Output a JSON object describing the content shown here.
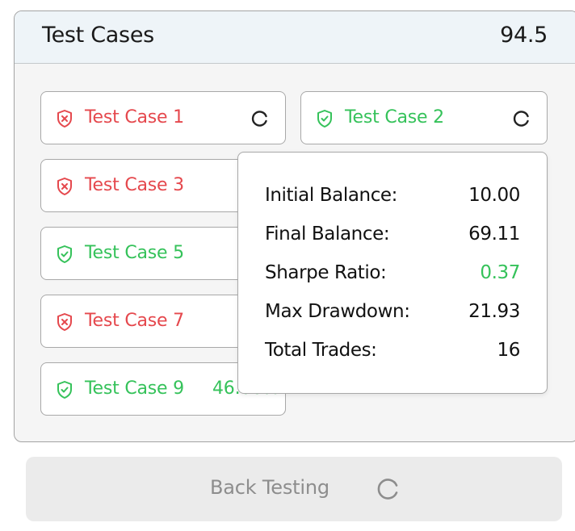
{
  "panel": {
    "title": "Test Cases",
    "score": "94.5"
  },
  "colors": {
    "fail": "#e5484d",
    "pass": "#35c25a",
    "header_bg": "#eef4f8",
    "panel_bg": "#f5f5f5",
    "button_bg": "#ebebeb"
  },
  "test_cases": [
    {
      "label": "Test Case 1",
      "status": "fail",
      "icon": "shield-x-icon",
      "loading": true
    },
    {
      "label": "Test Case 2",
      "status": "pass",
      "icon": "shield-check-icon",
      "loading": true
    },
    {
      "label": "Test Case 3",
      "status": "fail",
      "icon": "shield-x-icon"
    },
    {
      "label": "Test Case 5",
      "status": "pass",
      "icon": "shield-check-icon"
    },
    {
      "label": "Test Case 7",
      "status": "fail",
      "icon": "shield-x-icon"
    },
    {
      "label": "Test Case 9",
      "status": "pass",
      "icon": "shield-check-icon",
      "value": "46.06%"
    }
  ],
  "tooltip": {
    "metrics": [
      {
        "label": "Initial Balance:",
        "value": "10.00"
      },
      {
        "label": "Final Balance:",
        "value": "69.11"
      },
      {
        "label": "Sharpe Ratio:",
        "value": "0.37",
        "highlight": true
      },
      {
        "label": "Max Drawdown:",
        "value": "21.93"
      },
      {
        "label": "Total Trades:",
        "value": "16"
      }
    ]
  },
  "backtest_button": {
    "label": "Back Testing",
    "icon": "spinner-icon"
  }
}
